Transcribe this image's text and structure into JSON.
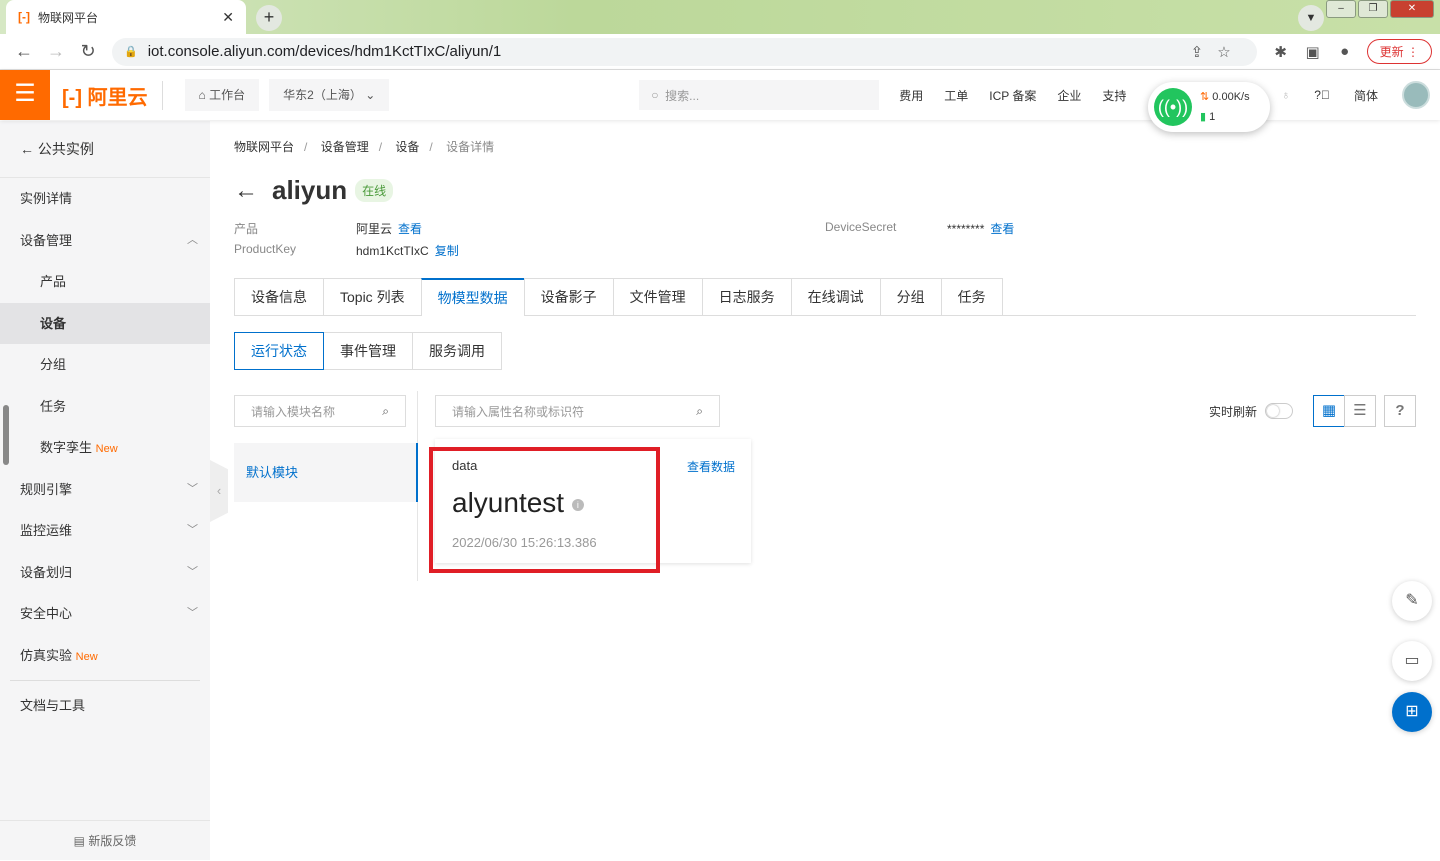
{
  "browser": {
    "tab_title": "物联网平台",
    "url": "iot.console.aliyun.com/devices/hdm1KctTIxC/aliyun/1",
    "update_label": "更新"
  },
  "header": {
    "logo": "阿里云",
    "workbench": "工作台",
    "region": "华东2（上海）",
    "search_placeholder": "搜索...",
    "links": [
      "费用",
      "工单",
      "ICP 备案",
      "企业",
      "支持"
    ],
    "lang": "简体"
  },
  "network": {
    "speed": "0.00K/s",
    "count": "1"
  },
  "sidebar": {
    "back": "公共实例",
    "items": [
      {
        "label": "实例详情",
        "level": 1
      },
      {
        "label": "设备管理",
        "level": 1,
        "expanded": true
      },
      {
        "label": "产品",
        "level": 2
      },
      {
        "label": "设备",
        "level": 2,
        "active": true
      },
      {
        "label": "分组",
        "level": 2
      },
      {
        "label": "任务",
        "level": 2
      },
      {
        "label": "数字孪生",
        "level": 2,
        "badge": "New"
      },
      {
        "label": "规则引擎",
        "level": 1,
        "collapsed": true
      },
      {
        "label": "监控运维",
        "level": 1,
        "collapsed": true
      },
      {
        "label": "设备划归",
        "level": 1,
        "collapsed": true
      },
      {
        "label": "安全中心",
        "level": 1,
        "collapsed": true
      },
      {
        "label": "仿真实验",
        "level": 1,
        "badge": "New"
      }
    ],
    "docs": "文档与工具",
    "feedback": "新版反馈"
  },
  "breadcrumb": [
    "物联网平台",
    "设备管理",
    "设备",
    "设备详情"
  ],
  "device": {
    "name": "aliyun",
    "status": "在线",
    "product_label": "产品",
    "product_value": "阿里云",
    "view": "查看",
    "productkey_label": "ProductKey",
    "productkey_value": "hdm1KctTIxC",
    "copy": "复制",
    "secret_label": "DeviceSecret",
    "secret_value": "********"
  },
  "tabs": [
    "设备信息",
    "Topic 列表",
    "物模型数据",
    "设备影子",
    "文件管理",
    "日志服务",
    "在线调试",
    "分组",
    "任务"
  ],
  "subtabs": [
    "运行状态",
    "事件管理",
    "服务调用"
  ],
  "module_search_placeholder": "请输入模块名称",
  "prop_search_placeholder": "请输入属性名称或标识符",
  "module": "默认模块",
  "realtime_label": "实时刷新",
  "realtime_on": false,
  "property": {
    "name": "data",
    "value": "alyuntest",
    "timestamp": "2022/06/30 15:26:13.386",
    "view_data": "查看数据"
  },
  "colors": {
    "accent": "#0070cc",
    "brand": "#ff6a00",
    "highlight": "#e01e26"
  }
}
